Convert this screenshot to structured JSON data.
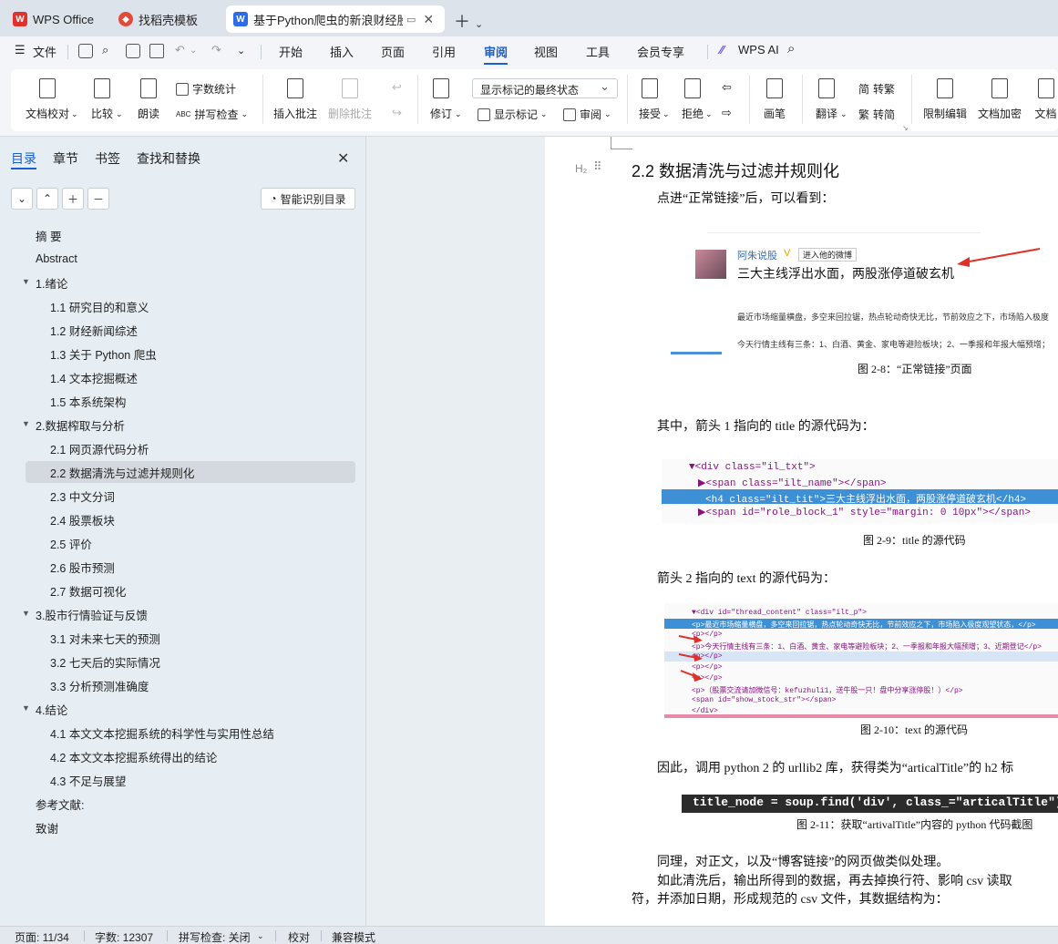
{
  "tabs": [
    {
      "label": "WPS Office"
    },
    {
      "label": "找稻壳模板"
    },
    {
      "label": "基于Python爬虫的新浪财经股"
    }
  ],
  "menu": {
    "file": "文件",
    "items": [
      "开始",
      "插入",
      "页面",
      "引用",
      "审阅",
      "视图",
      "工具",
      "会员专享"
    ],
    "active": "审阅",
    "ai": "WPS AI"
  },
  "ribbon": {
    "doc_check": "文档校对",
    "compare": "比较",
    "read": "朗读",
    "word_count": "字数统计",
    "spell_check": "拼写检查",
    "insert_comment": "插入批注",
    "delete_comment": "删除批注",
    "track": "修订",
    "markup_dropdown": "显示标记的最终状态",
    "show_markup": "显示标记",
    "review": "审阅",
    "accept": "接受",
    "reject": "拒绝",
    "pen": "画笔",
    "translate": "翻译",
    "to_trad": "转繁",
    "to_simp": "转简",
    "restrict_edit": "限制编辑",
    "doc_encrypt": "文档加密",
    "doc_perm": "文档"
  },
  "nav": {
    "tabs": [
      "目录",
      "章节",
      "书签",
      "查找和替换"
    ],
    "smart_toc": "智能识别目录",
    "toc": [
      {
        "label": "摘    要",
        "level": 1
      },
      {
        "label": "Abstract",
        "level": 1
      },
      {
        "label": "1.绪论",
        "level": 1,
        "expand": true
      },
      {
        "label": "1.1  研究目的和意义",
        "level": 2
      },
      {
        "label": "1.2  财经新闻综述",
        "level": 2
      },
      {
        "label": "1.3  关于 Python 爬虫",
        "level": 2
      },
      {
        "label": "1.4  文本挖掘概述",
        "level": 2
      },
      {
        "label": "1.5  本系统架构",
        "level": 2
      },
      {
        "label": "2.数据榨取与分析",
        "level": 1,
        "expand": true
      },
      {
        "label": "2.1  网页源代码分析",
        "level": 2
      },
      {
        "label": "2.2  数据清洗与过滤并规则化",
        "level": 2,
        "selected": true
      },
      {
        "label": "2.3  中文分词",
        "level": 2
      },
      {
        "label": "2.4  股票板块",
        "level": 2
      },
      {
        "label": "2.5  评价",
        "level": 2
      },
      {
        "label": "2.6  股市预测",
        "level": 2
      },
      {
        "label": "2.7  数据可视化",
        "level": 2
      },
      {
        "label": "3.股市行情验证与反馈",
        "level": 1,
        "expand": true
      },
      {
        "label": "3.1  对未来七天的预测",
        "level": 2
      },
      {
        "label": "3.2  七天后的实际情况",
        "level": 2
      },
      {
        "label": "3.3  分析预测准确度",
        "level": 2
      },
      {
        "label": "4.结论",
        "level": 1,
        "expand": true
      },
      {
        "label": "4.1  本文文本挖掘系统的科学性与实用性总结",
        "level": 2
      },
      {
        "label": "4.2  本文文本挖掘系统得出的结论",
        "level": 2
      },
      {
        "label": "4.3  不足与展望",
        "level": 2
      },
      {
        "label": "参考文献:",
        "level": 1
      },
      {
        "label": "致谢",
        "level": 1
      }
    ]
  },
  "doc": {
    "heading": "2.2  数据清洗与过滤并规则化",
    "heading_mark": "H₂",
    "p1": "点进“正常链接”后，可以看到：",
    "img1": {
      "user": "阿朱说股",
      "follow": "进入他的微博",
      "title": "三大主线浮出水面，两股涨停道破玄机",
      "line1": "最近市场缩量横盘，多空来回拉锯，热点轮动奇快无比，节前效应之下，市场陷入极度",
      "line2": "今天行情主线有三条：1、白酒、黄金、家电等避险板块；2、一季报和年报大幅预增；"
    },
    "cap1": "图 2-8：“正常链接”页面",
    "p2": "其中，箭头 1 指向的 title 的源代码为：",
    "code1": [
      "▼<div class=\"il_txt\">",
      "  ▶<span class=\"ilt_name\"></span>",
      "   <h4 class=\"ilt_tit\">三大主线浮出水面，两股涨停道破玄机</h4>",
      "  ▶<span id=\"role_block_1\" style=\"margin: 0 10px\"></span>"
    ],
    "cap2": "图 2-9：title 的源代码",
    "p3": "箭头 2 指向的 text 的源代码为：",
    "code2": [
      "▼<div id=\"thread_content\" class=\"ilt_p\">",
      "  <p>最近市场缩量横盘，多空来回拉锯，热点轮动奇快无比，节前效应之下，市场陷入极度观望状态，</p>",
      "  <p></p>",
      "  <p>今天行情主线有三条：1、白酒、黄金、家电等避险板块；2、一季报和年报大幅预增；3、近期登记</p>",
      "  <p></p>",
      "  <p></p>",
      "  <p></p>",
      "  <p>（股票交流请加微信号：kefuzhuli1，送牛股一只！盘中分享涨停股！）</p>",
      "  <span id=\"show_stock_str\"></span>",
      "</div>"
    ],
    "cap3": "图 2-10：text 的源代码",
    "p4": "因此，调用 python 2 的 urllib2 库，获得类为“articalTitle”的 h2 标",
    "code3": "title_node = soup.find('div', class_=\"articalTitle\")",
    "cap4": "图 2-11：获取“artivalTitle”内容的 python 代码截图",
    "p5": "同理，对正文，以及“博客链接”的网页做类似处理。",
    "p6": "如此清洗后，输出所得到的数据，再去掉换行符、影响 csv 读取",
    "p7": "符，并添加日期，形成规范的 csv 文件，其数据结构为："
  },
  "status": {
    "page": "页面: 11/34",
    "words": "字数: 12307",
    "spell": "拼写检查: 关闭",
    "proof": "校对",
    "compat": "兼容模式"
  },
  "colors": {
    "accent": "#1a5fd0",
    "selection": "#3d8fd6"
  }
}
